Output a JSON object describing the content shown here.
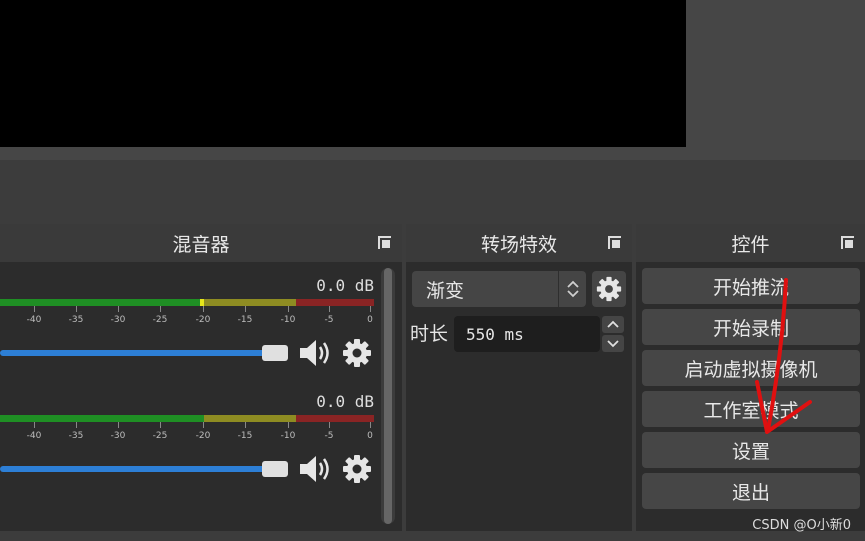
{
  "mixer": {
    "title": "混音器",
    "tracks": [
      {
        "db": "0.0 dB",
        "volume": 0.92
      },
      {
        "db": "0.0 dB",
        "volume": 0.92
      }
    ],
    "tick_labels": [
      "-40",
      "-35",
      "-30",
      "-25",
      "-20",
      "-15",
      "-10",
      "-5",
      "0"
    ]
  },
  "transitions": {
    "title": "转场特效",
    "selected": "渐变",
    "duration_label": "时长",
    "duration_value": "550 ms"
  },
  "controls": {
    "title": "控件",
    "buttons": [
      "开始推流",
      "开始录制",
      "启动虚拟摄像机",
      "工作室模式",
      "设置",
      "退出"
    ]
  },
  "colors": {
    "meter_green": "#1f8f24",
    "meter_yellow": "#8e8c22",
    "meter_red": "#8a2424",
    "slider_blue": "#2d7fd6",
    "annotation_red": "#e01010"
  },
  "watermark": "CSDN @O小新0"
}
